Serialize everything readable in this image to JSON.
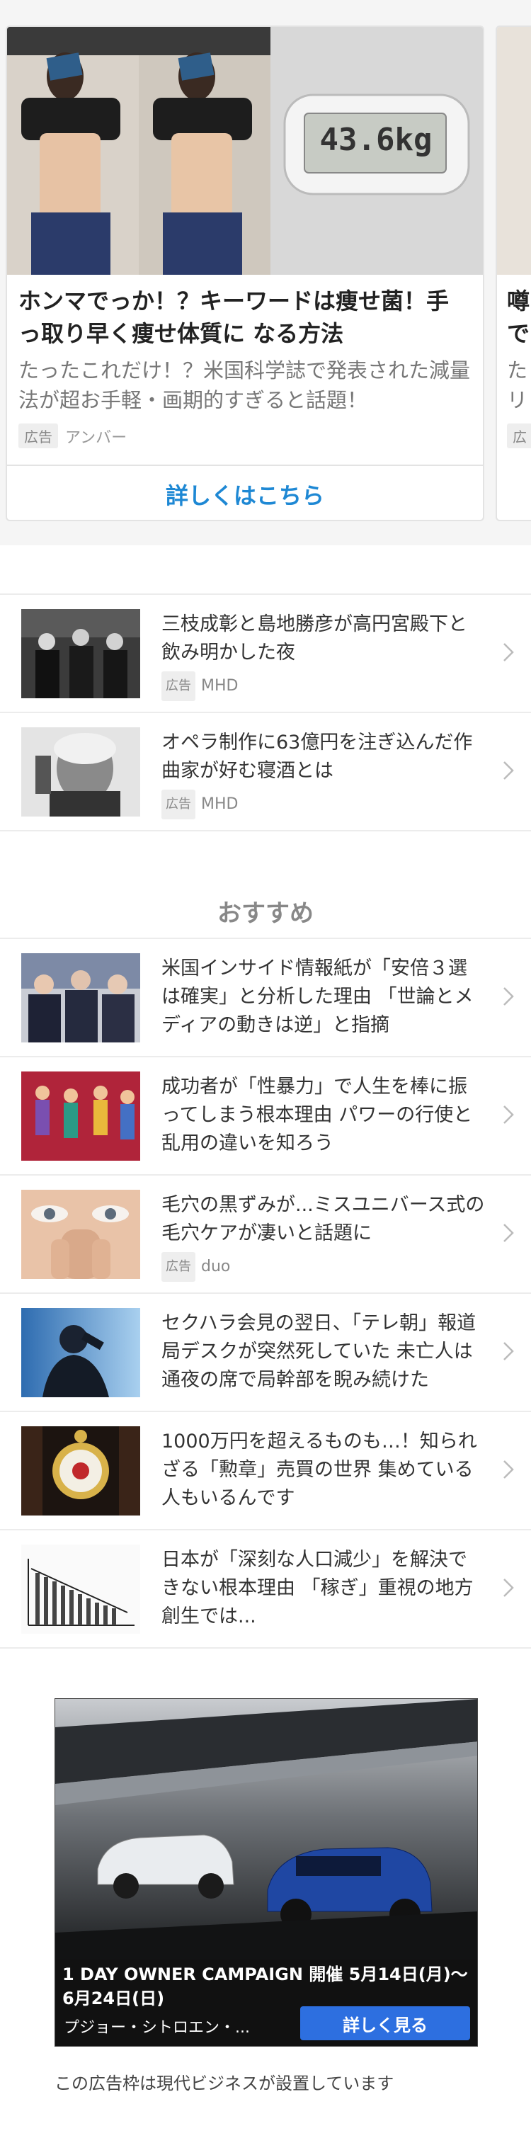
{
  "carousel": {
    "main_card": {
      "title": "ホンマでっか！？キーワードは痩せ菌！手っ取り早く痩せ体質に なる方法",
      "description": "たったこれだけ！？米国科学誌で発表された減量法が超お手軽・画期的すぎると話題！",
      "ad_label": "広告",
      "sponsor": "アンバー",
      "cta": "詳しくはこちら",
      "scale_reading": "43.6kg"
    },
    "next_card": {
      "title": "噂\nで",
      "description": "た\nリ",
      "ad_label": "広"
    }
  },
  "ad_list": [
    {
      "text": "三枝成彰と島地勝彦が高円宮殿下と飲み明かした夜",
      "ad_label": "広告",
      "sponsor": "MHD"
    },
    {
      "text": "オペラ制作に63億円を注ぎ込んだ作曲家が好む寝酒とは",
      "ad_label": "広告",
      "sponsor": "MHD"
    }
  ],
  "recommend": {
    "title": "おすすめ",
    "items": [
      {
        "text": "米国インサイド情報紙が「安倍３選は確実」と分析した理由 「世論とメディアの動きは逆」と指摘"
      },
      {
        "text": "成功者が「性暴力」で人生を棒に振ってしまう根本理由 パワーの行使と乱用の違いを知ろう"
      },
      {
        "text": "毛穴の黒ずみが...ミスユニバース式の毛穴ケアが凄いと話題に",
        "ad_label": "広告",
        "sponsor": "duo"
      },
      {
        "text": "セクハラ会見の翌日、「テレ朝」報道局デスクが突然死していた 未亡人は通夜の席で局幹部を睨み続けた"
      },
      {
        "text": "1000万円を超えるものも…！知られざる「勲章」売買の世界 集めている人もいるんです"
      },
      {
        "text": "日本が「深刻な人口減少」を解決できない根本理由 「稼ぎ」重視の地方創生では..."
      }
    ]
  },
  "bottom_ad": {
    "caption": "1 DAY OWNER CAMPAIGN 開催 5月14日(月)〜6月24日(日)",
    "advertiser": "プジョー・シトロエン・...",
    "cta": "詳しく見る",
    "footer": "この広告枠は現代ビジネスが設置しています"
  },
  "colors": {
    "link_blue": "#1e88d4",
    "cta_blue": "#2d6fe0",
    "divider": "#ececec"
  }
}
